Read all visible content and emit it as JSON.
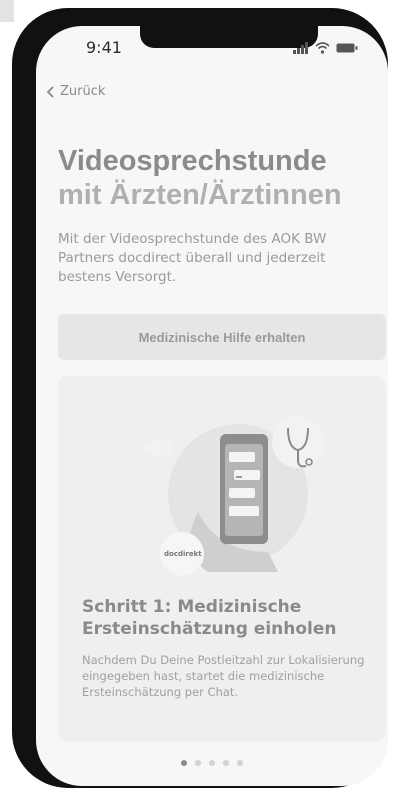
{
  "status_bar": {
    "time": "9:41"
  },
  "nav": {
    "back_label": "Zurück"
  },
  "hero": {
    "title_line1": "Videosprechstunde",
    "title_line2": "mit Ärzten/Ärztinnen",
    "intro": "Mit der Videosprechstunde des AOK BW Partners docdirect überall und jederzeit bestens Versorgt."
  },
  "cta": {
    "label": "Medizinische Hilfe erhalten"
  },
  "card": {
    "brand_badge": "docdirekt",
    "step_title": "Schritt 1: Medizinische Ersteinschätzung einholen",
    "step_desc": "Nachdem Du Deine Postleitzahl zur Lokalisierung eingegeben hast, startet die medizinische Ersteinschätzung per Chat."
  },
  "pagination": {
    "total": 5,
    "active_index": 0
  },
  "colors": {
    "frame": "#111111",
    "screen_bg": "#f7f7f7",
    "muted_text": "#9a9a9a"
  }
}
